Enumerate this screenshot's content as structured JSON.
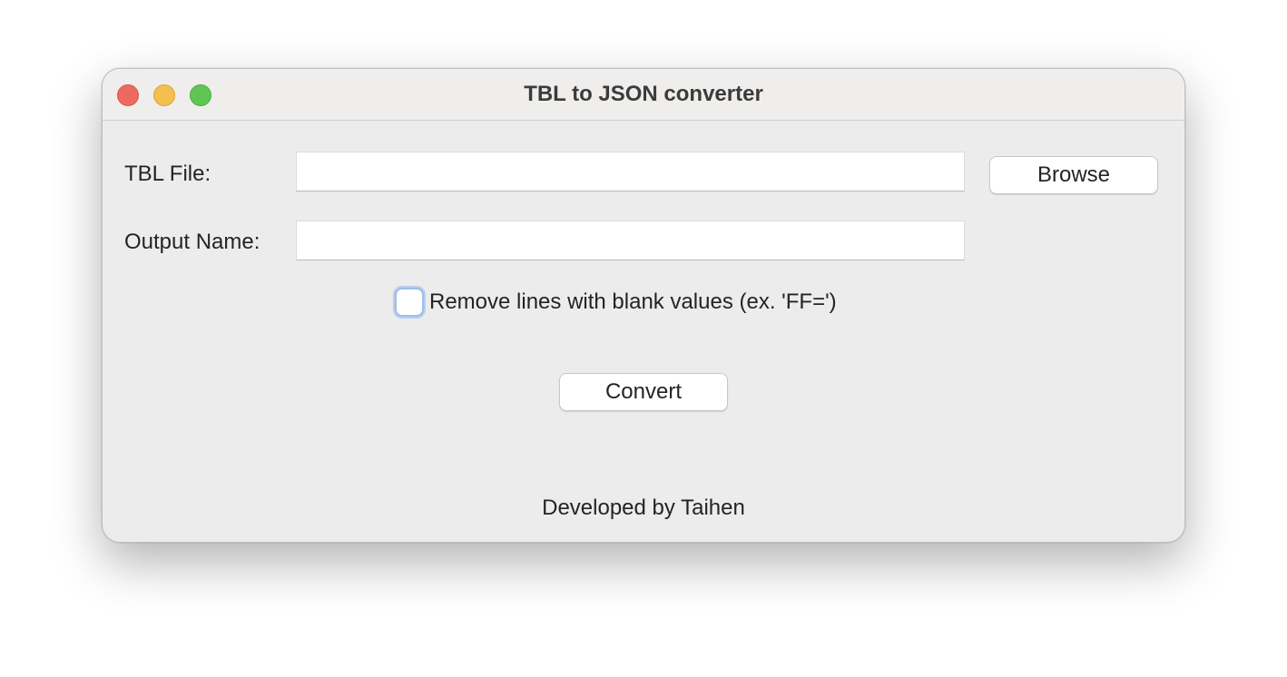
{
  "window": {
    "title": "TBL to JSON converter"
  },
  "form": {
    "tbl_file_label": "TBL File:",
    "tbl_file_value": "",
    "output_name_label": "Output Name:",
    "output_name_value": "",
    "browse_label": "Browse",
    "remove_blank_label": "Remove lines with blank values (ex. 'FF=')",
    "remove_blank_checked": false,
    "convert_label": "Convert"
  },
  "footer": {
    "credit": "Developed by Taihen"
  },
  "colors": {
    "close": "#ec6a5e",
    "minimize": "#f4bf4f",
    "maximize": "#61c554",
    "focus_ring": "#9cbef0"
  }
}
